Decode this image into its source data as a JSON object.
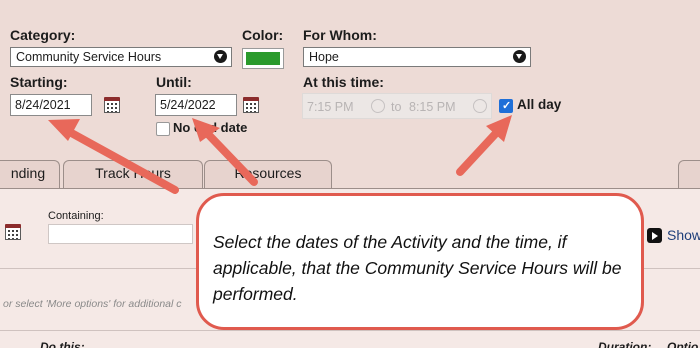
{
  "form": {
    "category_label": "Category:",
    "category_value": "Community Service Hours",
    "color_label": "Color:",
    "color_value": "#2a9a2c",
    "for_whom_label": "For Whom:",
    "for_whom_value": "Hope",
    "starting_label": "Starting:",
    "starting_value": "8/24/2021",
    "until_label": "Until:",
    "until_value": "5/24/2022",
    "no_end_date_label": "No end date",
    "no_end_date_checked": false,
    "at_this_time_label": "At this time:",
    "start_time": "7:15 PM",
    "to_label": "to",
    "end_time": "8:15 PM",
    "all_day_label": "All day",
    "all_day_checked": true
  },
  "tabs": [
    "nding",
    "Track Hours",
    "Resources",
    ""
  ],
  "filter": {
    "containing_label": "Containing:",
    "containing_value": "",
    "show_label": "Show",
    "more_options_text": "or select 'More options' for additional c"
  },
  "table_headers": {
    "do_this": "Do this:",
    "duration": "Duration:",
    "options": "Optio"
  },
  "callout": {
    "text": "Select the dates of the Activity and the time, if applicable, that the Community Service Hours will be performed."
  },
  "colors": {
    "background": "#eddbd6",
    "arrow": "#e8685a",
    "callout_border": "#e05a4e"
  }
}
